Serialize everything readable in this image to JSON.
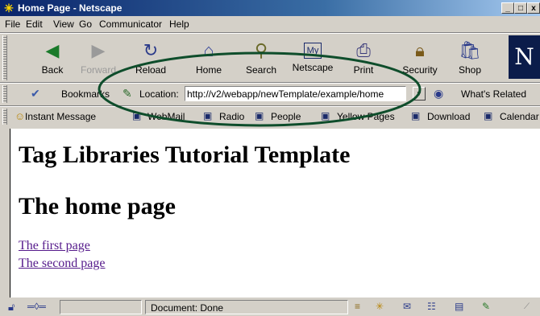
{
  "window": {
    "title": "Home Page - Netscape",
    "minimize": "_",
    "maximize": "□",
    "close": "x"
  },
  "menu": [
    "File",
    "Edit",
    "View",
    "Go",
    "Communicator",
    "Help"
  ],
  "toolbar": {
    "back": "Back",
    "forward": "Forward",
    "reload": "Reload",
    "home": "Home",
    "search": "Search",
    "netscape": "Netscape",
    "print": "Print",
    "security": "Security",
    "shop": "Shop"
  },
  "location": {
    "bookmarks": "Bookmarks",
    "label": "Location:",
    "url": "http://v2/webapp/newTemplate/example/home",
    "whats_related": "What's Related"
  },
  "personal": {
    "instant_message": "Instant Message",
    "webmail": "WebMail",
    "radio": "Radio",
    "people": "People",
    "yellow_pages": "Yellow Pages",
    "download": "Download",
    "calendar": "Calendar"
  },
  "page": {
    "heading1": "Tag Libraries Tutorial Template",
    "heading2": "The home page",
    "link1": "The first page",
    "link2": "The second page"
  },
  "status": {
    "text": "Document: Done"
  },
  "colors": {
    "title_bar": "#0a246a",
    "link_visited": "#551a8b",
    "annotation_ellipse": "#0e4d2b"
  }
}
